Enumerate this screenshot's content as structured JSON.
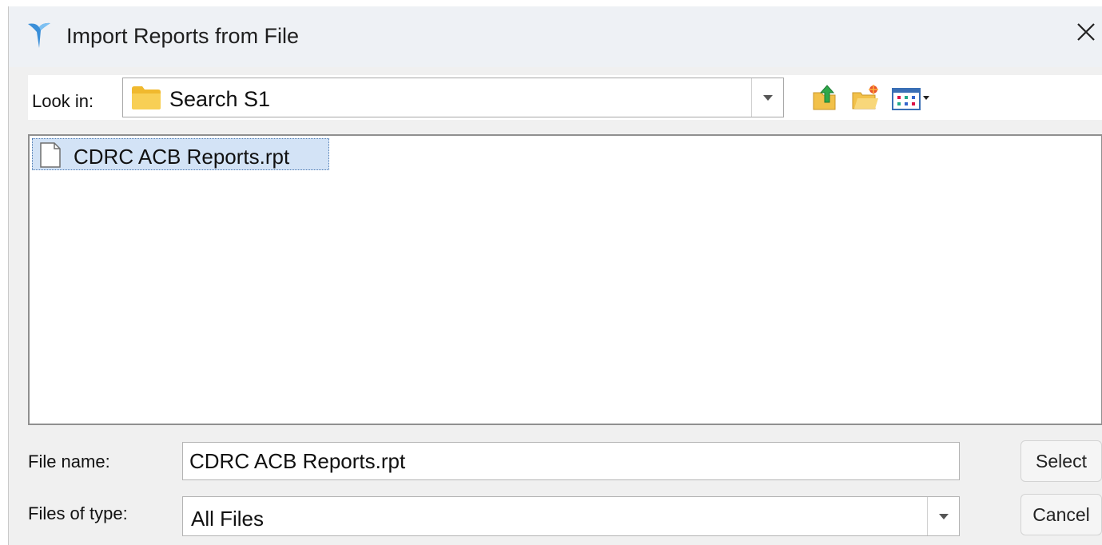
{
  "window": {
    "title": "Import Reports from File",
    "icons": {
      "app": "app-logo-icon",
      "close": "close-icon"
    }
  },
  "lookin": {
    "label": "Look in:",
    "value": "Search S1",
    "icon": "folder-icon",
    "toolbar": [
      "up-one-level-icon",
      "create-new-folder-icon",
      "view-menu-icon"
    ]
  },
  "files": [
    {
      "name": "CDRC ACB Reports.rpt",
      "icon": "file-icon",
      "selected": true
    }
  ],
  "file_name": {
    "label": "File name:",
    "value": "CDRC ACB Reports.rpt"
  },
  "file_type": {
    "label": "Files of type:",
    "value": "All Files"
  },
  "buttons": {
    "select": "Select",
    "cancel": "Cancel"
  },
  "colors": {
    "selection": "#d3e3f6",
    "folder": "#f6c344",
    "accent": "#2f7fd6"
  }
}
